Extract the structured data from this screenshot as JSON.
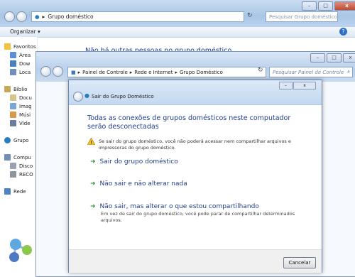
{
  "back_window": {
    "breadcrumb": "Grupo doméstico",
    "search_placeholder": "Pesquisar Grupo doméstico",
    "toolbar_organizar": "Organizar ▾",
    "content_title": "Não há outras pessoas no grupo doméstico",
    "nav": {
      "favoritos": "Favoritos",
      "area": "Área",
      "downloads": "Dow",
      "locais": "Loca",
      "bibliotecas": "Biblio",
      "documentos": "Docu",
      "imagens": "Imag",
      "musicas": "Músi",
      "videos": "Víde",
      "grupo": "Grupo",
      "computador": "Compu",
      "disco": "Disco",
      "recovery": "RECO",
      "rede": "Rede"
    }
  },
  "middle_window": {
    "address": {
      "part1": "Painel de Controle",
      "part2": "Rede e Internet",
      "part3": "Grupo Doméstico"
    },
    "search_placeholder": "Pesquisar Painel de Controle"
  },
  "dialog": {
    "title": "Sair do Grupo Doméstico",
    "heading": "Todas as conexões de grupos domésticos neste computador serão desconectadas",
    "warning": "Se sair do grupo doméstico, você não poderá acessar nem compartilhar arquivos e impressoras do grupo doméstico.",
    "options": [
      {
        "label": "Sair do grupo doméstico",
        "sub": ""
      },
      {
        "label": "Não sair e não alterar nada",
        "sub": ""
      },
      {
        "label": "Não sair, mas alterar o que estou compartilhando",
        "sub": "Em vez de sair do grupo doméstico, você pode parar de compartilhar determinados arquivos."
      }
    ],
    "cancel": "Cancelar"
  },
  "colors": {
    "link_blue": "#1e3e8c",
    "arrow_green": "#2d9a3a",
    "close_red": "#c04a33"
  }
}
